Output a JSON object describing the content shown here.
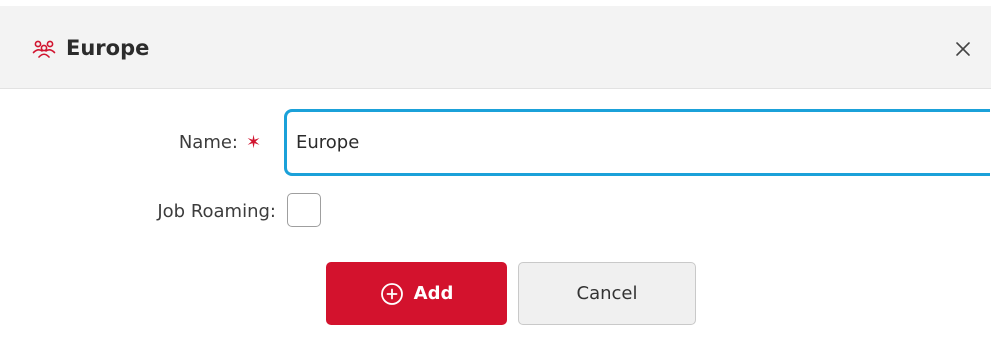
{
  "dialog": {
    "title": "Europe",
    "title_icon": "user-group-icon",
    "close_icon": "close-icon",
    "close_glyph": "×"
  },
  "form": {
    "name_label": "Name:",
    "required_marker": "✶",
    "name_value": "Europe",
    "job_roaming_label": "Job Roaming:",
    "job_roaming_checked": false
  },
  "buttons": {
    "add_label": "Add",
    "add_icon": "plus-circle-icon",
    "cancel_label": "Cancel"
  },
  "colors": {
    "accent_red": "#d3122d",
    "focus_border": "#1ba1d9",
    "header_bg": "#f3f3f3"
  }
}
